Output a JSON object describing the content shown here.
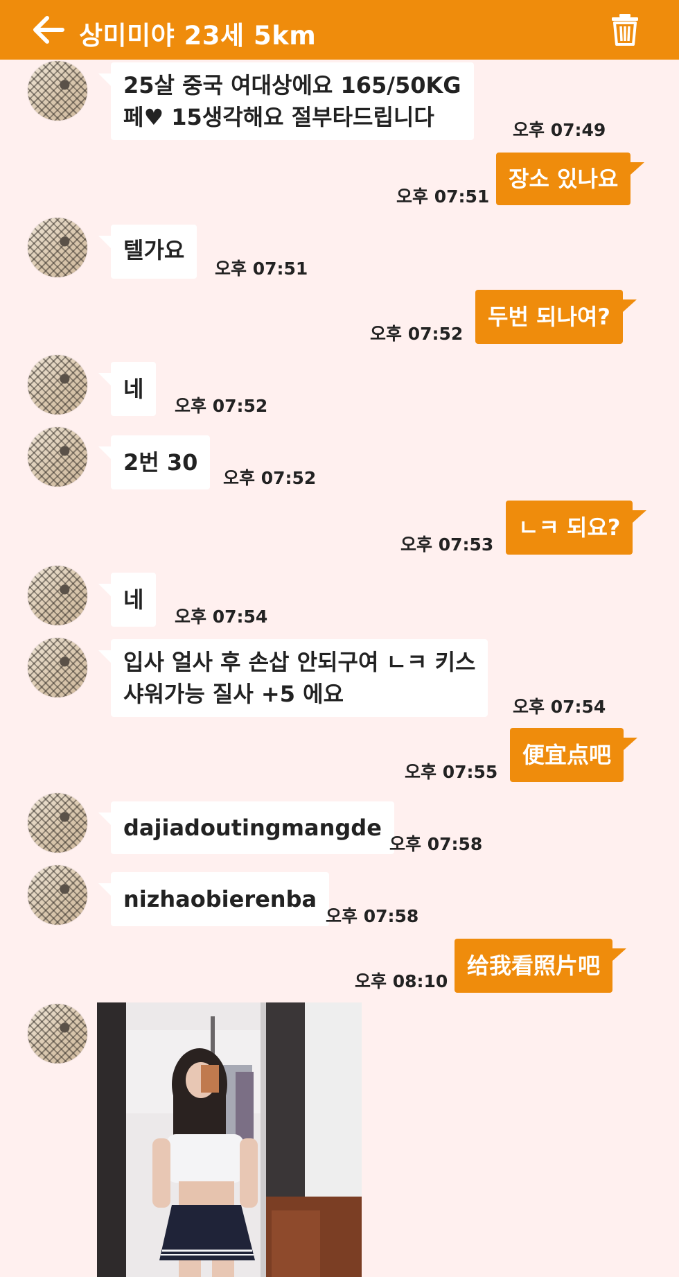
{
  "header": {
    "title": "상미미야 23세 5km",
    "back_icon": "arrow-left-icon",
    "delete_icon": "trash-icon",
    "bg_color": "#ef8c0c"
  },
  "colors": {
    "background": "#fff0ef",
    "outgoing_bubble": "#ef8c0c",
    "incoming_bubble": "#ffffff"
  },
  "messages": [
    {
      "from": "them",
      "lines": [
        "25살 중국 여대상에요  165/50KG",
        "페♥ 15생각해요 절부타드립니다"
      ],
      "time": "오후 07:49"
    },
    {
      "from": "me",
      "text": "장소 있나요",
      "time": "오후 07:51"
    },
    {
      "from": "them",
      "text": "텔가요",
      "time": "오후 07:51"
    },
    {
      "from": "me",
      "text": "두번 되나여?",
      "time": "오후 07:52"
    },
    {
      "from": "them",
      "text": "네",
      "time": "오후 07:52"
    },
    {
      "from": "them",
      "text": "2번 30",
      "time": "오후 07:52"
    },
    {
      "from": "me",
      "text": "ㄴㅋ 되요?",
      "time": "오후 07:53"
    },
    {
      "from": "them",
      "text": "네",
      "time": "오후 07:54"
    },
    {
      "from": "them",
      "lines": [
        "입사 얼사 후 손삽 안되구여 ㄴㅋ 키스",
        "샤워가능 질사 +5 에요"
      ],
      "time": "오후 07:54"
    },
    {
      "from": "me",
      "text": "便宜点吧",
      "time": "오후 07:55"
    },
    {
      "from": "them",
      "text": "dajiadoutingmangde",
      "time": "오후 07:58"
    },
    {
      "from": "them",
      "text": "nizhaobierenba",
      "time": "오후 07:58"
    },
    {
      "from": "me",
      "text": "给我看照片吧",
      "time": "오후 08:10"
    },
    {
      "from": "them",
      "type": "photo"
    }
  ]
}
